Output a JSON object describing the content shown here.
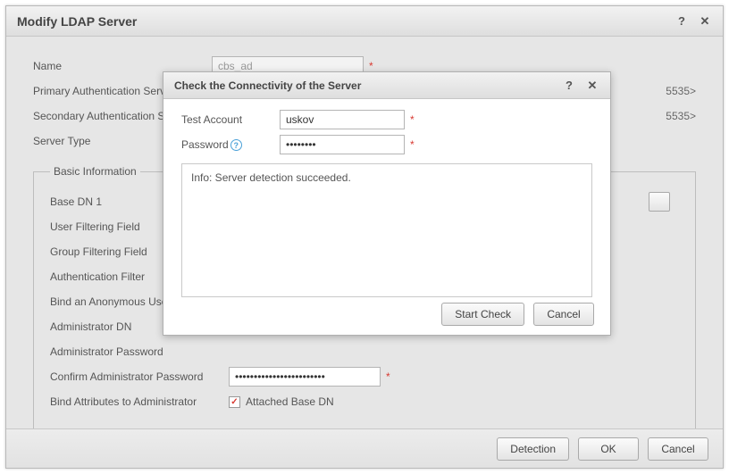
{
  "main": {
    "title": "Modify LDAP Server",
    "rows": {
      "name": {
        "label": "Name",
        "value": "cbs_ad"
      },
      "primary": {
        "label": "Primary Authentication Server IP",
        "after": "5535>"
      },
      "secondary": {
        "label": "Secondary Authentication Server IP",
        "after": "5535>"
      },
      "server_type": {
        "label": "Server Type"
      }
    },
    "basic": {
      "legend": "Basic Information",
      "base_dn": "Base DN 1",
      "user_filter": "User Filtering Field",
      "group_filter": "Group Filtering Field",
      "auth_filter": "Authentication Filter",
      "bind_anon": "Bind an Anonymous User",
      "admin_dn": "Administrator DN",
      "admin_pass": "Administrator Password",
      "confirm_admin_pass": {
        "label": "Confirm Administrator Password",
        "value": "••••••••••••••••••••••••"
      },
      "bind_attr": {
        "label": "Bind Attributes to Administrator",
        "checkbox_label": "Attached Base DN"
      }
    },
    "footer": {
      "detection": "Detection",
      "ok": "OK",
      "cancel": "Cancel"
    }
  },
  "modal": {
    "title": "Check the Connectivity of the Server",
    "test_account": {
      "label": "Test Account",
      "value": "uskov"
    },
    "password": {
      "label": "Password",
      "value": "••••••••"
    },
    "info": "Info: Server detection succeeded.",
    "start_check": "Start Check",
    "cancel": "Cancel"
  }
}
